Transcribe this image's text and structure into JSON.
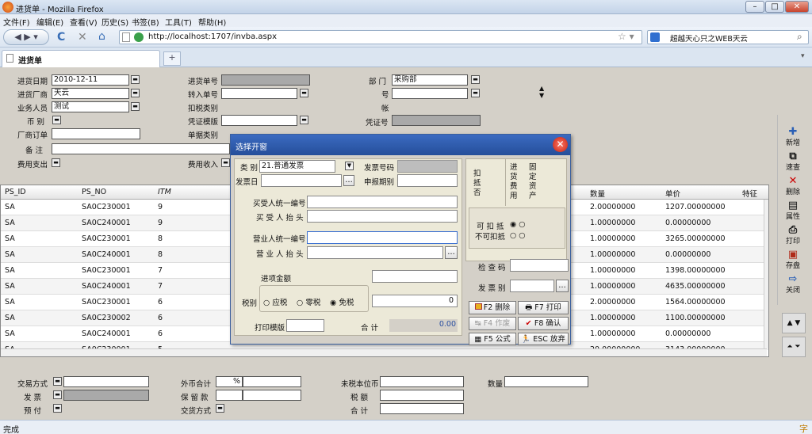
{
  "window": {
    "title": "进货单 - Mozilla Firefox"
  },
  "menu": [
    "文件(F)",
    "编辑(E)",
    "查看(V)",
    "历史(S)",
    "书签(B)",
    "工具(T)",
    "帮助(H)"
  ],
  "nav": {
    "url": "http://localhost:1707/invba.aspx",
    "search": "超越天心只之WEB天云"
  },
  "tab": {
    "title": "进货单",
    "new_tab": "+"
  },
  "header_form": {
    "date_label": "进货日期",
    "date_value": "2010-12-11",
    "vendor_label": "进货厂商",
    "vendor_value": "天云",
    "staff_label": "业务人员",
    "staff_value": "测试",
    "currency_label": "币  别",
    "vendor_order_label": "厂商订单",
    "note_label": "备  注",
    "expense_label": "费用支出",
    "doc_no_label": "进货单号",
    "transfer_label": "转入单号",
    "tax_type_label": "扣税类别",
    "voucher_tpl_label": "凭证模版",
    "doc_type_label": "单据类别",
    "income_label": "费用收入",
    "dept_label": "部  门",
    "dept_value": "采购部",
    "no_label": "号",
    "acct_label": "帐",
    "voucher_no_label": "凭证号"
  },
  "grid": {
    "columns": [
      "PS_ID",
      "PS_NO",
      "ITM",
      "数量",
      "单价",
      "特征"
    ],
    "rows": [
      {
        "ps_id": "SA",
        "ps_no": "SA0C230001",
        "itm": "9",
        "qty": "2.00000000",
        "price": "1207.00000000"
      },
      {
        "ps_id": "SA",
        "ps_no": "SA0C240001",
        "itm": "9",
        "qty": "1.00000000",
        "price": "0.00000000"
      },
      {
        "ps_id": "SA",
        "ps_no": "SA0C230001",
        "itm": "8",
        "qty": "1.00000000",
        "price": "3265.00000000"
      },
      {
        "ps_id": "SA",
        "ps_no": "SA0C240001",
        "itm": "8",
        "qty": "1.00000000",
        "price": "0.00000000"
      },
      {
        "ps_id": "SA",
        "ps_no": "SA0C230001",
        "itm": "7",
        "qty": "1.00000000",
        "price": "1398.00000000"
      },
      {
        "ps_id": "SA",
        "ps_no": "SA0C240001",
        "itm": "7",
        "qty": "1.00000000",
        "price": "4635.00000000"
      },
      {
        "ps_id": "SA",
        "ps_no": "SA0C230001",
        "itm": "6",
        "qty": "2.00000000",
        "price": "1564.00000000"
      },
      {
        "ps_id": "SA",
        "ps_no": "SA0C230002",
        "itm": "6",
        "qty": "1.00000000",
        "price": "1100.00000000"
      },
      {
        "ps_id": "SA",
        "ps_no": "SA0C240001",
        "itm": "6",
        "qty": "1.00000000",
        "price": "0.00000000"
      },
      {
        "ps_id": "SA",
        "ps_no": "SA0C230001",
        "itm": "5",
        "qty": "20.00000000",
        "price": "3143.00000000"
      }
    ]
  },
  "right_toolbar": [
    "新增",
    "速查",
    "删除",
    "属性",
    "打印",
    "存盘",
    "关闭"
  ],
  "footer_form": {
    "trade_label": "交易方式",
    "ticket_label": "发  票",
    "prepay_label": "预  付",
    "foreign_total_label": "外币合计",
    "percent": "%",
    "retain_label": "保 留 款",
    "delivery_label": "交货方式",
    "untaxed_label": "未税本位币",
    "tax_label": "税  额",
    "total_label": "合  计",
    "qty_label": "数量"
  },
  "modal": {
    "title": "选择开窗",
    "type_label": "类 别",
    "type_value": "21.普通发票",
    "invoice_no_label": "发票号码",
    "invoice_date_label": "发票日",
    "report_period_label": "申报期别",
    "buyer_id_label": "买受人统一编号",
    "buyer_name_label": "买 受 人 抬 头",
    "seller_id_label": "营业人统一编号",
    "seller_name_label": "营 业 人 抬 头",
    "amount_label": "进项金额",
    "tax_label": "税别",
    "tax_options": [
      "应税",
      "零税",
      "免税"
    ],
    "tax_amount": "0",
    "print_tpl_label": "打印模版",
    "total_label": "合  计",
    "total_value": "0.00",
    "col_deduct": "扣抵否",
    "col_purchase": "进货费用",
    "col_asset": "固定资产",
    "deductible_label": "可 扣 抵",
    "nondeductible_label": "不可扣抵",
    "check_code_label": "检 查 码",
    "ticket_type_label": "发 票 别",
    "buttons": {
      "del": "F2 删除",
      "print": "F7 打印",
      "act": "F4 作废",
      "ok": "F8 确认",
      "formula": "F5 公式",
      "cancel": "ESC 放弃"
    }
  },
  "status": {
    "text": "完成"
  }
}
